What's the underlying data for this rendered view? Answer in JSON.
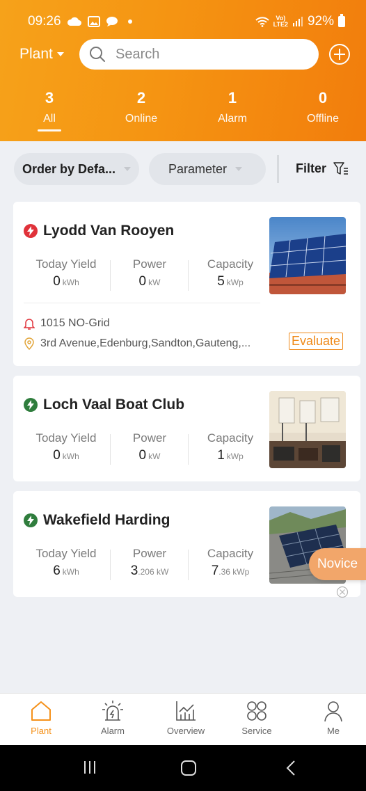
{
  "status_bar": {
    "time": "09:26",
    "network_top": "Vo)",
    "network_bottom": "LTE2",
    "battery": "92%",
    "icons": [
      "cloud-icon",
      "gallery-icon",
      "chat-icon",
      "wifi-icon",
      "signal-icon",
      "battery-icon"
    ]
  },
  "header": {
    "selector_label": "Plant",
    "search_placeholder": "Search",
    "add_icon": "plus-circle-icon",
    "stats": [
      {
        "count": "3",
        "label": "All",
        "active": true
      },
      {
        "count": "2",
        "label": "Online",
        "active": false
      },
      {
        "count": "1",
        "label": "Alarm",
        "active": false
      },
      {
        "count": "0",
        "label": "Offline",
        "active": false
      }
    ]
  },
  "filters": {
    "order_label": "Order by Defa...",
    "parameter_label": "Parameter",
    "filter_label": "Filter"
  },
  "plants": [
    {
      "name": "Lyodd Van Rooyen",
      "status": "alarm",
      "metrics": [
        {
          "label": "Today Yield",
          "value": "0",
          "unit": "kWh"
        },
        {
          "label": "Power",
          "value": "0",
          "unit": "kW"
        },
        {
          "label": "Capacity",
          "value": "5",
          "unit": "kWp"
        }
      ],
      "alarm_text": "1015 NO-Grid",
      "address": "3rd Avenue,Edenburg,Sandton,Gauteng,...",
      "evaluate_label": "Evaluate"
    },
    {
      "name": "Loch Vaal Boat Club",
      "status": "online",
      "metrics": [
        {
          "label": "Today Yield",
          "value": "0",
          "unit": "kWh"
        },
        {
          "label": "Power",
          "value": "0",
          "unit": "kW"
        },
        {
          "label": "Capacity",
          "value": "1",
          "unit": "kWp"
        }
      ]
    },
    {
      "name": "Wakefield Harding",
      "status": "online",
      "metrics": [
        {
          "label": "Today Yield",
          "value": "6",
          "unit": "kWh"
        },
        {
          "label": "Power",
          "value": "3",
          "unit": ".206 kW"
        },
        {
          "label": "Capacity",
          "value": "7",
          "unit": ".36 kWp"
        }
      ]
    }
  ],
  "novice_label": "Novice",
  "tabs": [
    {
      "label": "Plant",
      "icon": "home-icon",
      "active": true
    },
    {
      "label": "Alarm",
      "icon": "alarm-icon",
      "active": false
    },
    {
      "label": "Overview",
      "icon": "chart-icon",
      "active": false
    },
    {
      "label": "Service",
      "icon": "service-icon",
      "active": false
    },
    {
      "label": "Me",
      "icon": "person-icon",
      "active": false
    }
  ],
  "colors": {
    "brand_orange": "#f5911a",
    "alarm_red": "#e0323a",
    "online_green": "#2f7d3d"
  }
}
